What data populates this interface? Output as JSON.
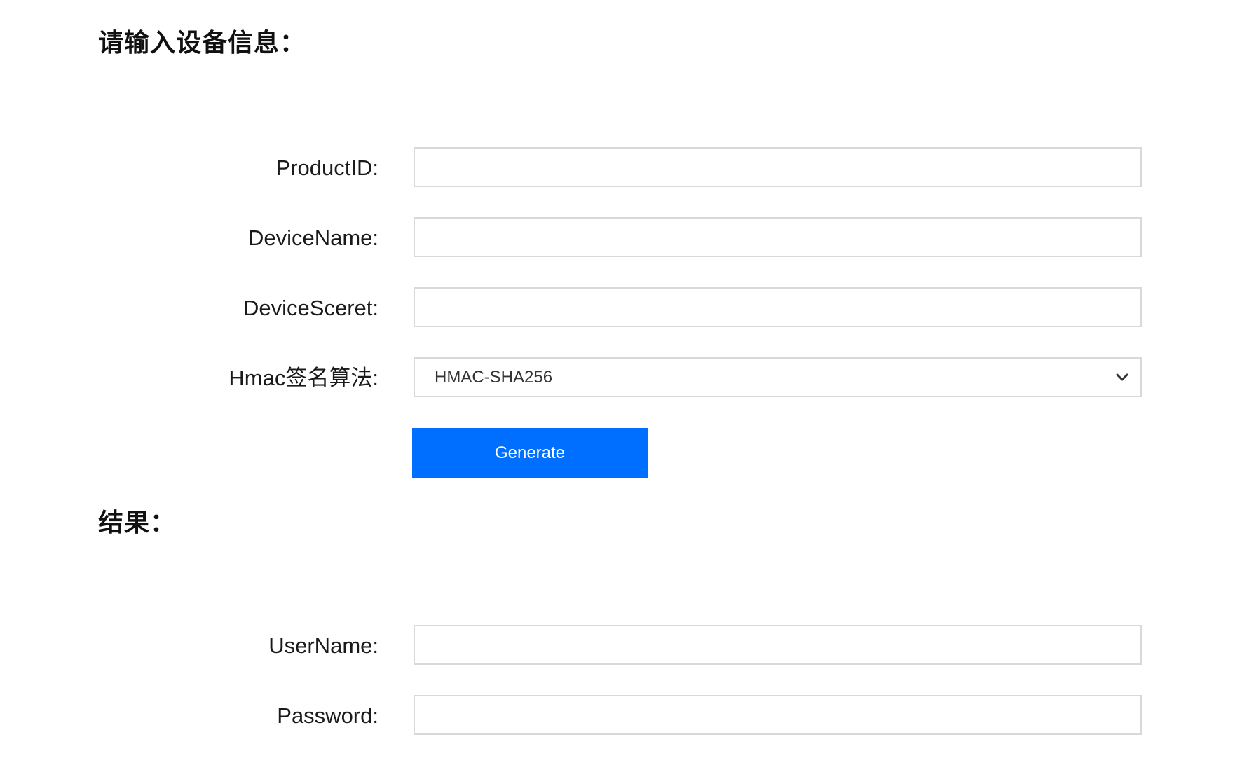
{
  "device_section": {
    "title": "请输入设备信息：",
    "fields": {
      "product_id": {
        "label": "ProductID:",
        "value": ""
      },
      "device_name": {
        "label": "DeviceName:",
        "value": ""
      },
      "device_secret": {
        "label": "DeviceSceret:",
        "value": ""
      },
      "hmac": {
        "label": "Hmac签名算法:",
        "selected": "HMAC-SHA256"
      }
    },
    "generate_label": "Generate"
  },
  "result_section": {
    "title": "结果：",
    "fields": {
      "username": {
        "label": "UserName:",
        "value": ""
      },
      "password": {
        "label": "Password:",
        "value": ""
      }
    }
  },
  "colors": {
    "primary_button": "#006eff",
    "input_border": "#d9d9d9"
  },
  "icons": {
    "select_arrow": "chevron-down-icon"
  }
}
